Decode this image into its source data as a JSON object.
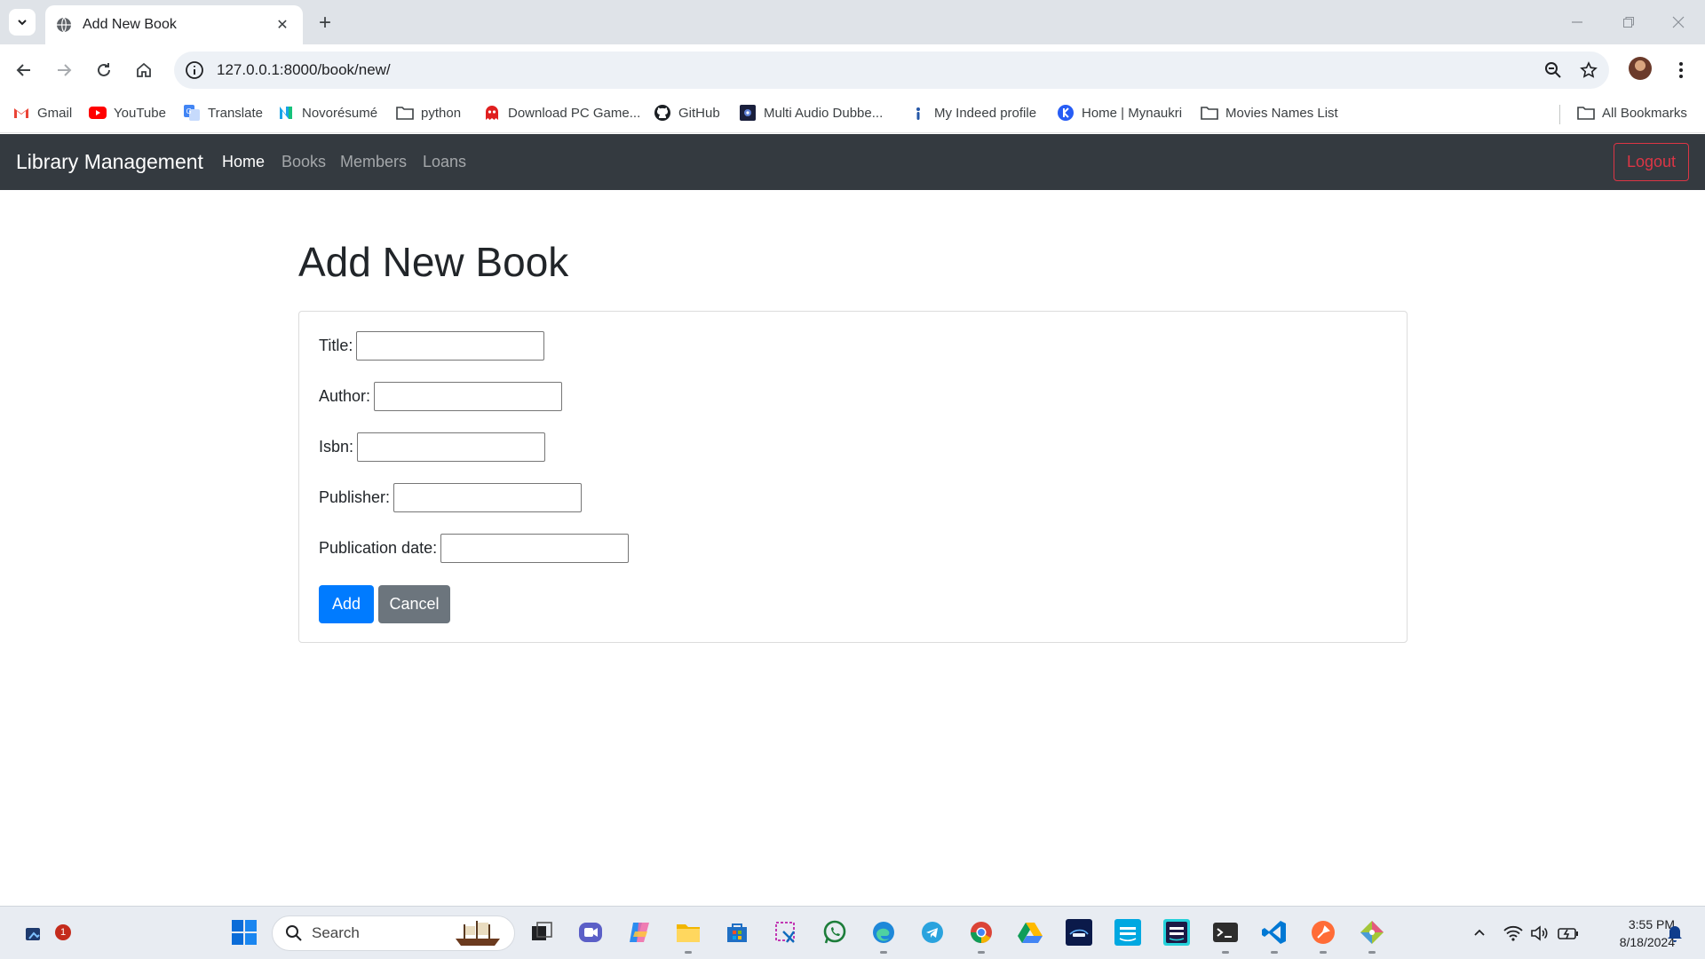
{
  "browser": {
    "tab_title": "Add New Book",
    "url": "127.0.0.1:8000/book/new/"
  },
  "bookmarks": [
    {
      "label": "Gmail",
      "icon": "gmail-icon"
    },
    {
      "label": "YouTube",
      "icon": "youtube-icon"
    },
    {
      "label": "Translate",
      "icon": "translate-icon"
    },
    {
      "label": "Novorésumé",
      "icon": "novoresume-icon"
    },
    {
      "label": "python",
      "icon": "folder-icon"
    },
    {
      "label": "Download PC Game...",
      "icon": "ghost-icon"
    },
    {
      "label": "GitHub",
      "icon": "github-icon"
    },
    {
      "label": "Multi Audio Dubbe...",
      "icon": "movie-icon"
    },
    {
      "label": "My Indeed profile",
      "icon": "indeed-icon"
    },
    {
      "label": "Home | Mynaukri",
      "icon": "naukri-icon"
    },
    {
      "label": "Movies Names List",
      "icon": "folder-icon"
    },
    {
      "label": "All Bookmarks",
      "icon": "folder-icon"
    }
  ],
  "navbar": {
    "brand": "Library Management",
    "links": [
      "Home",
      "Books",
      "Members",
      "Loans"
    ],
    "active": "Home",
    "logout": "Logout"
  },
  "page": {
    "heading": "Add New Book",
    "fields": [
      {
        "label": "Title:",
        "value": ""
      },
      {
        "label": "Author:",
        "value": ""
      },
      {
        "label": "Isbn:",
        "value": ""
      },
      {
        "label": "Publisher:",
        "value": ""
      },
      {
        "label": "Publication date:",
        "value": ""
      }
    ],
    "add_button": "Add",
    "cancel_button": "Cancel"
  },
  "taskbar": {
    "search_label": "Search",
    "notification_count": "1",
    "time": "3:55 PM",
    "date": "8/18/2024"
  },
  "colors": {
    "navbar": "#343a40",
    "primary": "#007bff",
    "secondary": "#6c757d",
    "danger": "#dc3545"
  }
}
